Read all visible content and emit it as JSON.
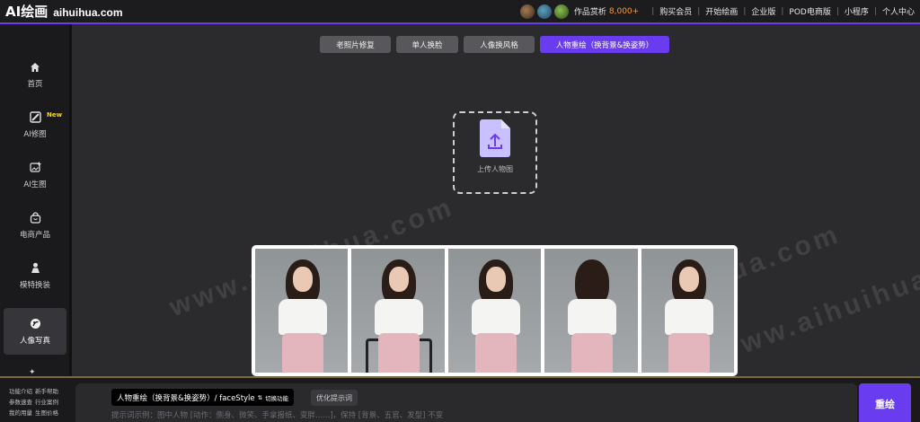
{
  "header": {
    "logo": "AI绘画",
    "domain": "aihuihua.com",
    "works_label": "作品赏析",
    "works_count": "8,000+",
    "nav": [
      "购买会员",
      "开始绘画",
      "企业版",
      "POD电商版",
      "小程序",
      "个人中心"
    ]
  },
  "sidebar": {
    "items": [
      {
        "label": "首页",
        "icon": "home-icon"
      },
      {
        "label": "AI修图",
        "icon": "edit-image-icon",
        "badge": "New"
      },
      {
        "label": "AI生图",
        "icon": "image-add-icon"
      },
      {
        "label": "电商产品",
        "icon": "shopping-bag-icon"
      },
      {
        "label": "模特换装",
        "icon": "model-icon"
      },
      {
        "label": "人像写真",
        "icon": "portrait-icon"
      }
    ]
  },
  "tabs": [
    "老照片修复",
    "单人换脸",
    "人像换风格",
    "人物重绘（换背景&换姿势）"
  ],
  "upload": {
    "label": "上传人物图"
  },
  "watermark": "www.aihuihua.com",
  "bottom": {
    "links": [
      "功能介绍",
      "新手帮助",
      "参数速查",
      "行业案例",
      "我的用量",
      "生图价格"
    ],
    "mode": "人物重绘（换背景&换姿势）/ faceStyle",
    "mode_switch": "切换功能",
    "optimize": "优化提示词",
    "placeholder": "提示词示例：图中人物 [动作：侧身、微笑、手拿报纸、变胖......]，保持 [背景、五官、发型] 不变",
    "submit": "重绘"
  },
  "colors": {
    "accent": "#6a3cf0",
    "works_count": "#ff9b2e",
    "new_badge": "#f5d90a"
  }
}
